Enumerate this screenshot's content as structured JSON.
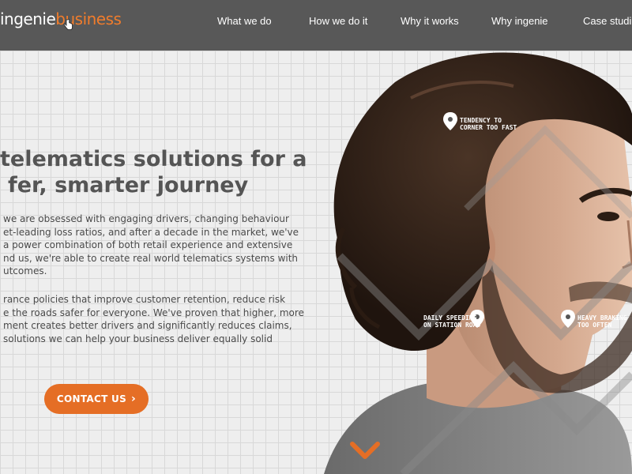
{
  "brand": {
    "name_part1": "ingenie",
    "name_part2": "business",
    "accent_color": "#f07c2c"
  },
  "nav": {
    "items": [
      {
        "label": "What we do"
      },
      {
        "label": "How we do it"
      },
      {
        "label": "Why it works"
      },
      {
        "label": "Why ingenie"
      },
      {
        "label": "Case studi"
      }
    ]
  },
  "hero": {
    "headline_line1": "telematics solutions for a",
    "headline_line2": "fer, smarter journey",
    "paragraph1": [
      "we are obsessed with engaging drivers, changing behaviour",
      "et-leading loss ratios, and after a decade in the market, we've",
      "a power combination of both retail experience and extensive",
      "nd us, we're able to create real world telematics systems with",
      "utcomes."
    ],
    "paragraph2": [
      "rance policies that improve customer retention, reduce risk",
      "e the roads safer for everyone. We've proven that higher, more",
      "ment creates better drivers and significantly reduces claims,",
      "solutions we can help your business deliver equally solid"
    ],
    "cta_label": "CONTACT US",
    "cta_chevron": "›",
    "annotations": [
      {
        "line1": "TENDENCY TO",
        "line2": "CORNER TOO FAST"
      },
      {
        "line1": "DAILY SPEEDING",
        "line2": "ON STATION ROAD"
      },
      {
        "line1": "HEAVY BRAKING",
        "line2": "TOO OFTEN"
      }
    ]
  },
  "icons": {
    "cursor": "hand-pointer-icon",
    "pins": "map-pin-icon",
    "scroll": "chevron-down-icon"
  },
  "colors": {
    "nav_bg": "#585858",
    "cta_bg": "#e56e25",
    "headline": "#555555"
  }
}
